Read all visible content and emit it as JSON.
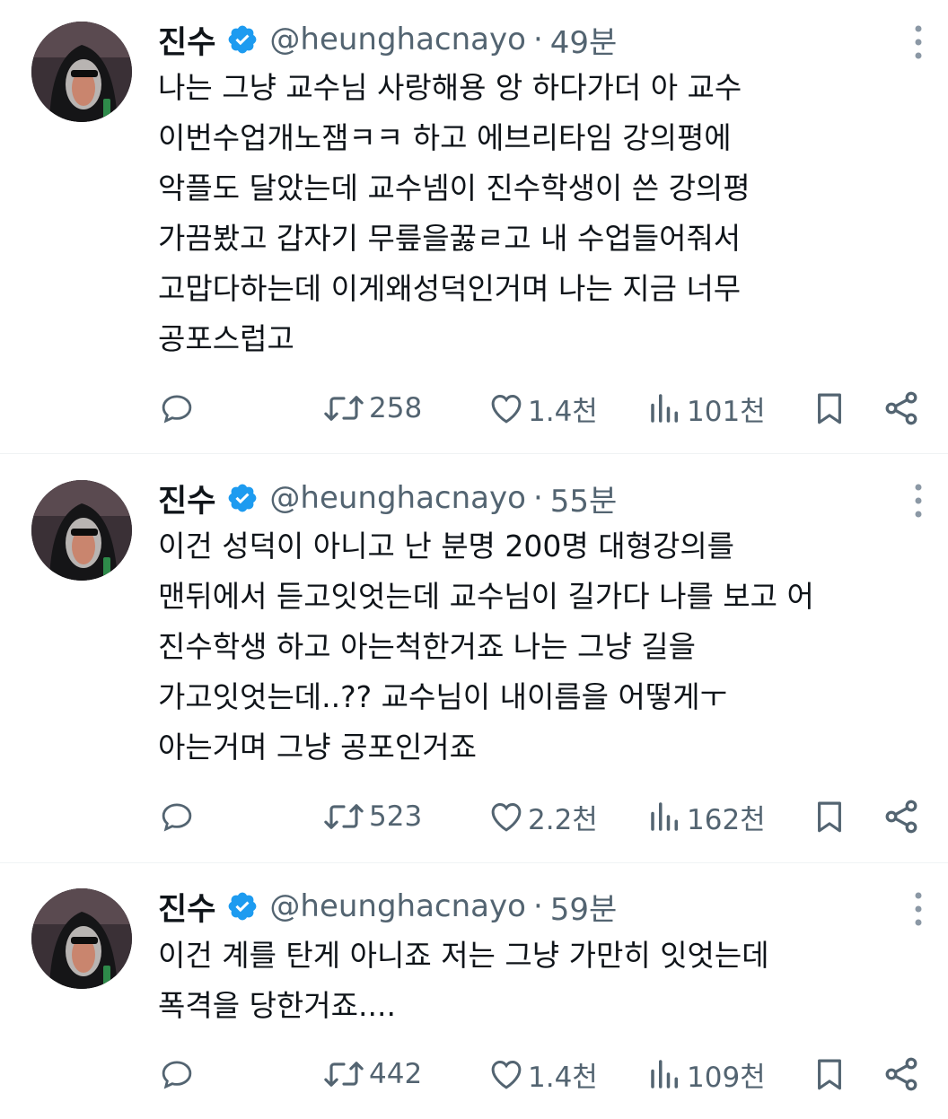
{
  "colors": {
    "verified": "#1d9bf0",
    "muted": "#536471",
    "text": "#0f1419",
    "divider": "#eff3f4"
  },
  "icons": [
    "reply-icon",
    "retweet-icon",
    "like-icon",
    "views-icon",
    "bookmark-icon",
    "share-icon",
    "more-icon",
    "verified-badge-icon"
  ],
  "tweets": [
    {
      "name": "진수",
      "handle": "@heunghacnayo",
      "separator": "·",
      "time": "49분",
      "lines": [
        "나는 그냥 교수님 사랑해용 앙 하다가더 아 교수",
        "이번수업개노잼ㅋㅋ  하고 에브리타임 강의평에",
        "악플도 달았는데 교수넴이 진수학생이 쓴 강의평",
        "가끔봤고 갑자기 무릎을꿇ㄹ고 내 수업들어줘서",
        "고맙다하는데 이게왜성덕인거며 나는 지금 너무",
        "공포스럽고"
      ],
      "retweets": "258",
      "likes": "1.4천",
      "views": "101천"
    },
    {
      "name": "진수",
      "handle": "@heunghacnayo",
      "separator": "·",
      "time": "55분",
      "lines": [
        "이건 성덕이 아니고 난 분명 200명 대형강의를",
        "맨뒤에서 듣고잇엇는데 교수님이 길가다 나를 보고 어",
        "진수학생 하고 아는척한거죠 나는 그냥 길을",
        "가고잇엇는데..?? 교수님이 내이름을 어떻게ㅜ",
        "아는거며 그냥 공포인거죠"
      ],
      "retweets": "523",
      "likes": "2.2천",
      "views": "162천"
    },
    {
      "name": "진수",
      "handle": "@heunghacnayo",
      "separator": "·",
      "time": "59분",
      "lines": [
        "이건 계를 탄게 아니죠 저는 그냥 가만히 잇엇는데",
        "폭격을 당한거죠...."
      ],
      "retweets": "442",
      "likes": "1.4천",
      "views": "109천"
    }
  ]
}
